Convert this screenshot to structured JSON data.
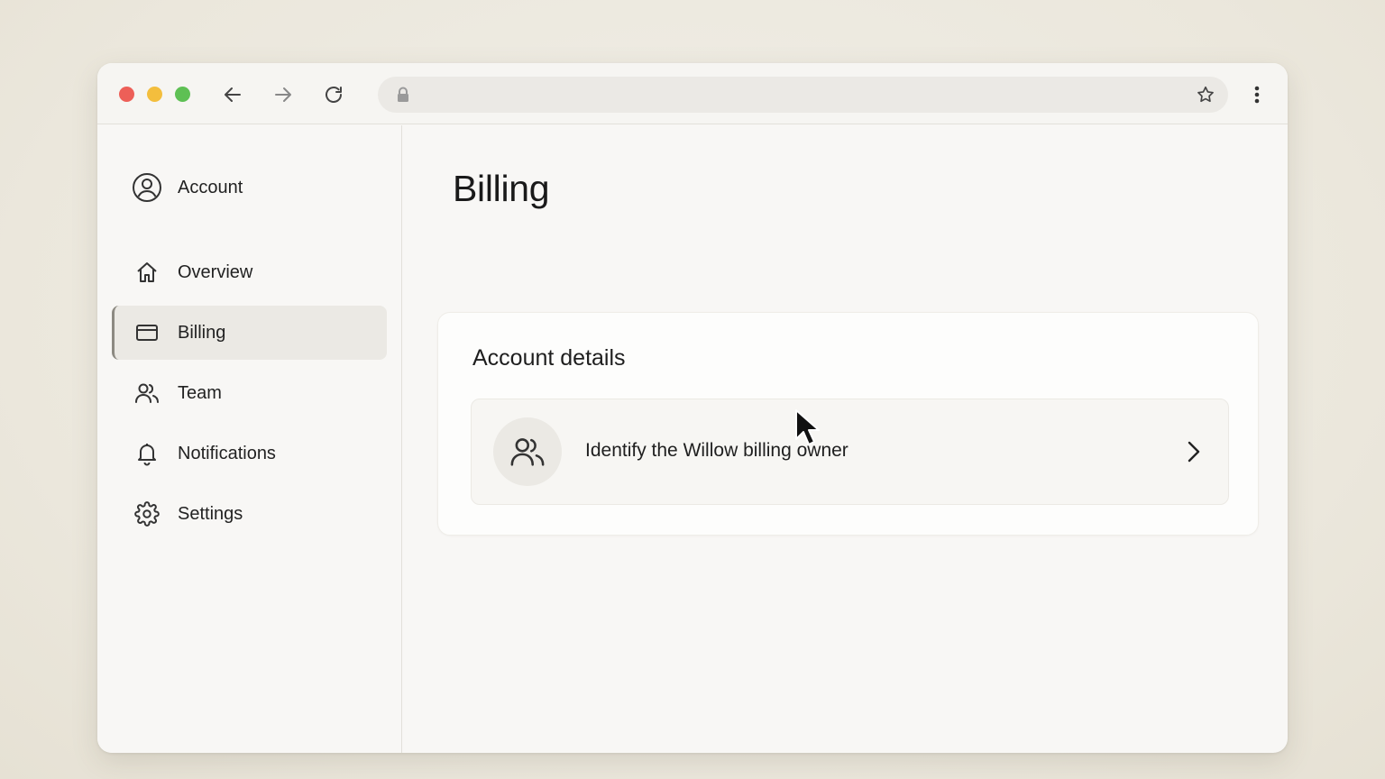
{
  "browser": {
    "url": "",
    "icons": {
      "back": "arrow-left-icon",
      "forward": "arrow-right-icon",
      "reload": "reload-icon",
      "lock": "lock-icon",
      "bookmark": "star-icon",
      "menu": "more-vertical-icon"
    }
  },
  "sidebar": {
    "account_label": "Account",
    "items": [
      {
        "label": "Overview",
        "icon": "home-icon",
        "active": false
      },
      {
        "label": "Billing",
        "icon": "credit-card-icon",
        "active": true
      },
      {
        "label": "Team",
        "icon": "users-icon",
        "active": false
      },
      {
        "label": "Notifications",
        "icon": "bell-icon",
        "active": false
      },
      {
        "label": "Settings",
        "icon": "gear-icon",
        "active": false
      }
    ]
  },
  "main": {
    "title": "Billing",
    "card": {
      "title": "Account details",
      "row": {
        "label": "Identify the Willow billing owner",
        "icon": "users-icon"
      }
    }
  },
  "colors": {
    "window_controls": [
      "#ed5f58",
      "#f3be3d",
      "#5ec054"
    ],
    "active_nav_bg": "#ebe9e4",
    "text": "#1f1f1f"
  }
}
